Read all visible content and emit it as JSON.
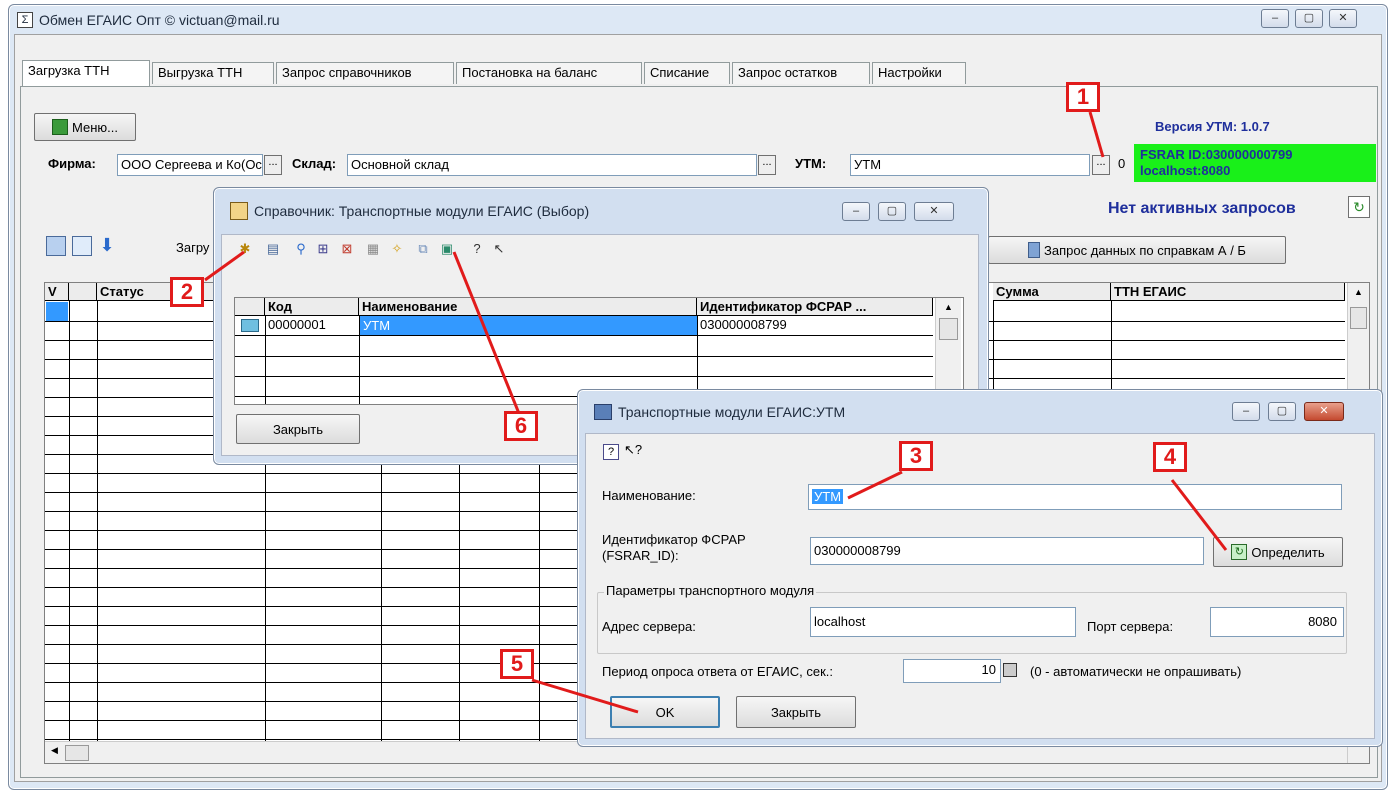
{
  "main": {
    "title": "Обмен ЕГАИС Опт  © victuan@mail.ru",
    "tabs": [
      "Загрузка ТТН",
      "Выгрузка ТТН",
      "Запрос справочников",
      "Постановка на баланс",
      "Списание",
      "Запрос остатков",
      "Настройки"
    ],
    "menu_label": "Меню...",
    "firm_label": "Фирма:",
    "firm_value": "ООО Сергеева и Ко(Основной уче",
    "warehouse_label": "Склад:",
    "warehouse_value": "Основной склад",
    "utm_label": "УТМ:",
    "utm_value": "УТМ",
    "utm_count": "0",
    "version": "Версия УТМ: 1.0.7",
    "fsrar_line1": "FSRAR ID:030000000799",
    "fsrar_line2": "localhost:8080",
    "no_requests": "Нет активных запросов",
    "load_label": "Загру",
    "request_ab": "Запрос данных по справкам А / Б",
    "columns": {
      "v": "V",
      "status": "Статус",
      "sum": "Сумма",
      "ttn": "ТТН ЕГАИС"
    }
  },
  "dir_window": {
    "title": "Справочник: Транспортные модули ЕГАИС (Выбор)",
    "columns": {
      "code": "Код",
      "name": "Наименование",
      "fsrar": "Идентификатор ФСРАР ..."
    },
    "rows": [
      {
        "code": "00000001",
        "name": "УТМ",
        "fsrar": "030000008799"
      }
    ],
    "close": "Закрыть"
  },
  "utm_window": {
    "title": "Транспортные модули ЕГАИС:УТМ",
    "name_label": "Наименование:",
    "name_value": "УТМ",
    "fsrar_label1": "Идентификатор ФСРАР",
    "fsrar_label2": "(FSRAR_ID):",
    "fsrar_value": "030000008799",
    "detect": "Определить",
    "group_label": "Параметры транспортного модуля",
    "server_label": "Адрес сервера:",
    "server_value": "localhost",
    "port_label": "Порт сервера:",
    "port_value": "8080",
    "period_label": "Период опроса ответа от ЕГАИС, сек.:",
    "period_value": "10",
    "period_note": "(0 - автоматически не опрашивать)",
    "ok": "OK",
    "close": "Закрыть"
  },
  "markers": [
    "1",
    "2",
    "3",
    "4",
    "5",
    "6"
  ],
  "colors": {
    "accent_blue": "#1f2f9c",
    "fsrar_bg": "#19f019",
    "marker": "#e11b1b",
    "selection": "#3399ff"
  }
}
